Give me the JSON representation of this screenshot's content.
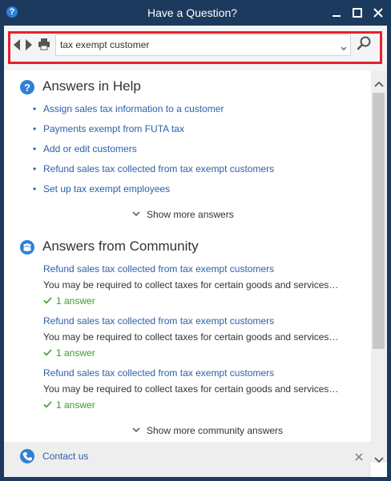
{
  "window": {
    "title": "Have a Question?",
    "app_icon": "?"
  },
  "toolbar": {
    "search_value": "tax exempt customer",
    "icons": [
      "back-arrow-icon",
      "forward-arrow-icon",
      "printer-icon",
      "chevron-down-icon",
      "search-icon"
    ]
  },
  "help": {
    "heading": "Answers in Help",
    "links": [
      "Assign sales tax information to a customer",
      "Payments exempt from FUTA tax",
      "Add or edit customers",
      "Refund sales tax collected from tax exempt customers",
      "Set up tax exempt employees"
    ],
    "show_more": "Show more answers"
  },
  "community": {
    "heading": "Answers from Community",
    "items": [
      {
        "title": "Refund sales tax collected from tax exempt customers",
        "desc": "You may be required to collect taxes for certain goods and services…",
        "count": "1 answer"
      },
      {
        "title": "Refund sales tax collected from tax exempt customers",
        "desc": "You may be required to collect taxes for certain goods and services…",
        "count": "1 answer"
      },
      {
        "title": "Refund sales tax collected from tax exempt customers",
        "desc": "You may be required to collect taxes for certain goods and services…",
        "count": "1 answer"
      }
    ],
    "show_more": "Show more community answers"
  },
  "footer": {
    "contact": "Contact us"
  },
  "colors": {
    "title_bar": "#1c3a5e",
    "link": "#2d5fa8",
    "answer_count": "#3a9a2a",
    "highlight_border": "#e8202a",
    "help_icon": "#2f7fd8"
  }
}
